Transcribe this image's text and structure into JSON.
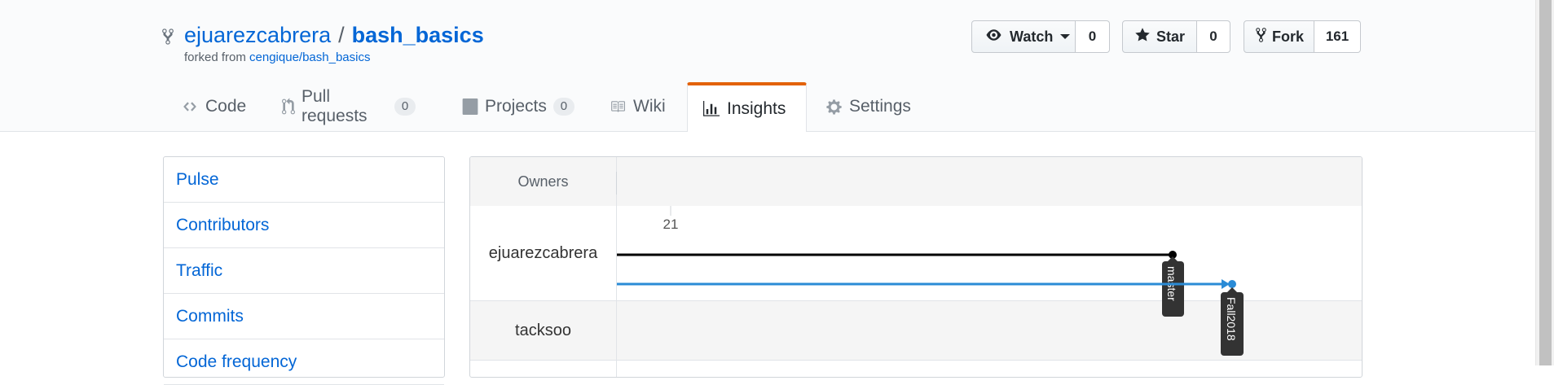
{
  "repo": {
    "owner": "ejuarezcabrera",
    "separator": "/",
    "name": "bash_basics",
    "forked_prefix": "forked from",
    "forked_from": "cengique/bash_basics"
  },
  "actions": {
    "watch": {
      "label": "Watch",
      "count": "0"
    },
    "star": {
      "label": "Star",
      "count": "0"
    },
    "fork": {
      "label": "Fork",
      "count": "161"
    }
  },
  "tabs": [
    {
      "label": "Code",
      "icon": "code-icon"
    },
    {
      "label": "Pull requests",
      "counter": "0",
      "icon": "pull-request-icon"
    },
    {
      "label": "Projects",
      "counter": "0",
      "icon": "project-icon"
    },
    {
      "label": "Wiki",
      "icon": "book-icon"
    },
    {
      "label": "Insights",
      "icon": "graph-icon",
      "selected": true
    },
    {
      "label": "Settings",
      "icon": "gear-icon"
    }
  ],
  "sidebar": {
    "items": [
      {
        "label": "Pulse"
      },
      {
        "label": "Contributors"
      },
      {
        "label": "Traffic"
      },
      {
        "label": "Commits"
      },
      {
        "label": "Code frequency"
      }
    ]
  },
  "network": {
    "header": "Owners",
    "date_label": "21",
    "owners": [
      "ejuarezcabrera",
      "tacksoo"
    ],
    "branches": [
      {
        "name": "master",
        "color": "#000000"
      },
      {
        "name": "Fall2018",
        "color": "#2a8bd6"
      }
    ]
  },
  "colors": {
    "link": "#0366d6",
    "tab_accent": "#e36209",
    "branch_blue": "#2a8bd6",
    "branch_black": "#000000"
  }
}
